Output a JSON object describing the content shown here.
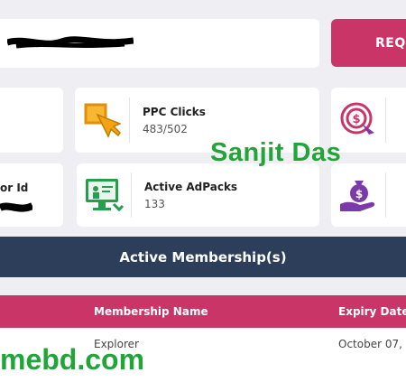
{
  "top": {
    "request_label": "REQU"
  },
  "stats": [
    {
      "label": "PPC Clicks",
      "value": "483/502",
      "icon": "cursor-click-icon"
    },
    {
      "label": "or Id",
      "icon": "id-icon"
    },
    {
      "label": "Active AdPacks",
      "value": "133",
      "icon": "adpack-monitor-icon"
    },
    {
      "icon": "target-dollar-icon"
    },
    {
      "icon": "money-bag-hand-icon"
    }
  ],
  "watermark": {
    "name": "Sanjit Das",
    "site": "mebd.com"
  },
  "membership": {
    "title": "Active Membership(s)",
    "columns": [
      "Membership Name",
      "Expiry Date"
    ],
    "rows": [
      {
        "name": "Explorer",
        "expiry": "October 07,"
      }
    ]
  },
  "colors": {
    "accent": "#c93566",
    "navy": "#2c3e59",
    "orange": "#f2a30f",
    "green": "#22a04a",
    "purple": "#7b3aa8"
  }
}
